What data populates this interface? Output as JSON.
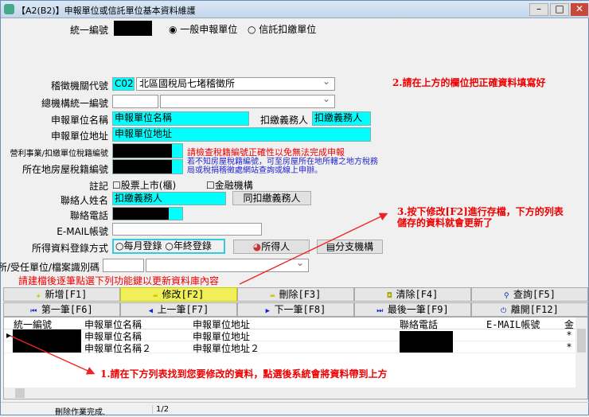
{
  "window": {
    "title": "【A2(B2)】申報單位或信託單位基本資料維護"
  },
  "form": {
    "tax_id_label": "統一編號",
    "radio_general": "一般申報單位",
    "radio_trust": "信託扣繳單位",
    "office_code_label": "稽徵機關代號",
    "office_code": "C02",
    "office_name": "北區國稅局七堵稽徵所",
    "hq_id_label": "總機構統一編號",
    "unit_name_label": "申報單位名稱",
    "unit_name": "申報單位名稱",
    "withholder_label": "扣繳義務人",
    "withholder": "扣繳義務人",
    "unit_address_label": "申報單位地址",
    "unit_address": "申報單位地址",
    "business_tax_label": "營利事業/扣繳單位稅籍編號",
    "business_tax_note": "請檢查稅籍編號正確性以免無法完成申報",
    "house_tax_label": "所在地房屋稅籍編號",
    "house_tax_note": "若不知房屋稅籍編號，可至房屋所在地所轄之地方稅務局或稅捐稽徵處網站查詢或線上申辦。",
    "remark_label": "註記",
    "check_listed": "股票上市(櫃)",
    "check_financial": "金融機構",
    "contact_label": "聯絡人姓名",
    "contact": "扣繳義務人",
    "same_as_button": "同扣繳義務人",
    "phone_label": "聯絡電話",
    "email_label": "E-MAIL帳號",
    "income_method_label": "所得資料登錄方式",
    "radio_monthly": "每月登錄",
    "radio_yearly": "年終登錄",
    "recipient_button": "所得人",
    "branch_button": "分支機構",
    "office_id_label": "事務所/受任單位/檔案識別碼",
    "hint": "請建檔後逐筆點選下列功能鍵以更新資料庫內容"
  },
  "buttons": [
    {
      "label": "新增[F1]",
      "icon": "plus-icon"
    },
    {
      "label": "修改[F2]",
      "icon": "edit-icon"
    },
    {
      "label": "刪除[F3]",
      "icon": "minus-icon"
    },
    {
      "label": "清除[F4]",
      "icon": "clear-icon"
    },
    {
      "label": "查詢[F5]",
      "icon": "search-icon"
    },
    {
      "label": "第一筆[F6]",
      "icon": "first-icon"
    },
    {
      "label": "上一筆[F7]",
      "icon": "prev-icon"
    },
    {
      "label": "下一筆[F8]",
      "icon": "next-icon"
    },
    {
      "label": "最後一筆[F9]",
      "icon": "last-icon"
    },
    {
      "label": "離開[F12]",
      "icon": "power-icon"
    }
  ],
  "grid": {
    "columns": [
      "統一編號",
      "申報單位名稱",
      "申報單位地址",
      "聯絡電話",
      "E-MAIL帳號",
      "金"
    ],
    "rows": [
      {
        "name": "申報單位名稱",
        "address": "申報單位地址",
        "flag": "*"
      },
      {
        "name": "申報單位名稱２",
        "address": "申報單位地址２",
        "flag": "*"
      }
    ]
  },
  "status": {
    "message": "刪除作業完成.",
    "record": "1/2"
  },
  "annotations": {
    "step1": "1.請在下方列表找到您要修改的資料，點選後系統會將資料帶到上方",
    "step2": "2.請在上方的欄位把正確資料填寫好",
    "step3": "3.按下修改[F2]進行存檔，下方的列表儲存的資料就會更新了"
  }
}
